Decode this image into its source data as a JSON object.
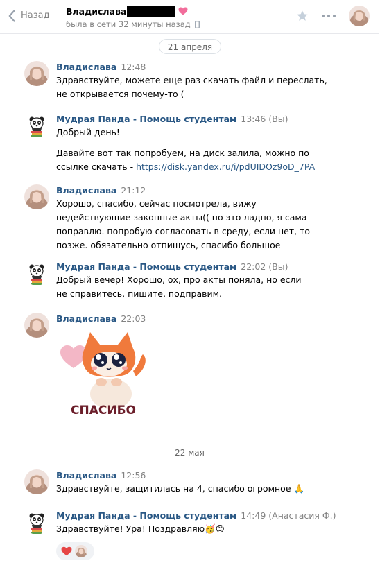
{
  "header": {
    "back_label": "Назад",
    "peer_name": "Владислава",
    "status": "была в сети 32 минуты назад"
  },
  "dates": [
    "21 апреля",
    "22 мая"
  ],
  "messages": [
    {
      "author": "Владислава",
      "time": "12:48",
      "extra": "",
      "lines": [
        "Здравствуйте, можете еще раз скачать файл и переслать, не открывается почему-то ("
      ]
    },
    {
      "author": "Мудрая Панда - Помощь студентам",
      "time": "13:46",
      "extra": "(Вы)",
      "lines": [
        "Добрый день!",
        "Давайте вот так попробуем, на диск залила, можно по ссылке скачать - "
      ],
      "link": "https://disk.yandex.ru/i/pdUIDOz9oD_7PA"
    },
    {
      "author": "Владислава",
      "time": "21:12",
      "extra": "",
      "lines": [
        "Хорошо, спасибо, сейчас посмотрела, вижу недействующие законные акты(( но это ладно, я сама поправлю. попробую согласовать в среду, если нет, то позже. обязательно отпишусь, спасибо большое"
      ]
    },
    {
      "author": "Мудрая Панда - Помощь студентам",
      "time": "22:02",
      "extra": "(Вы)",
      "lines": [
        "Добрый вечер! Хорошо, ох, про акты поняла, но если не справитесь, пишите, подправим."
      ]
    },
    {
      "author": "Владислава",
      "time": "22:03",
      "extra": "",
      "sticker_text": "СПАСИБО"
    },
    {
      "author": "Владислава",
      "time": "12:56",
      "extra": "",
      "lines": [
        "Здравствуйте, защитилась на 4, спасибо огромное 🙏"
      ]
    },
    {
      "author": "Мудрая Панда - Помощь студентам",
      "time": "14:49",
      "extra": "(Анастасия Ф.)",
      "lines": [
        "Здравствуйте! Ура! Поздравляю🥳😊"
      ]
    }
  ],
  "colors": {
    "link": "#2a5885",
    "muted": "#828282",
    "heart": "#e64646"
  }
}
